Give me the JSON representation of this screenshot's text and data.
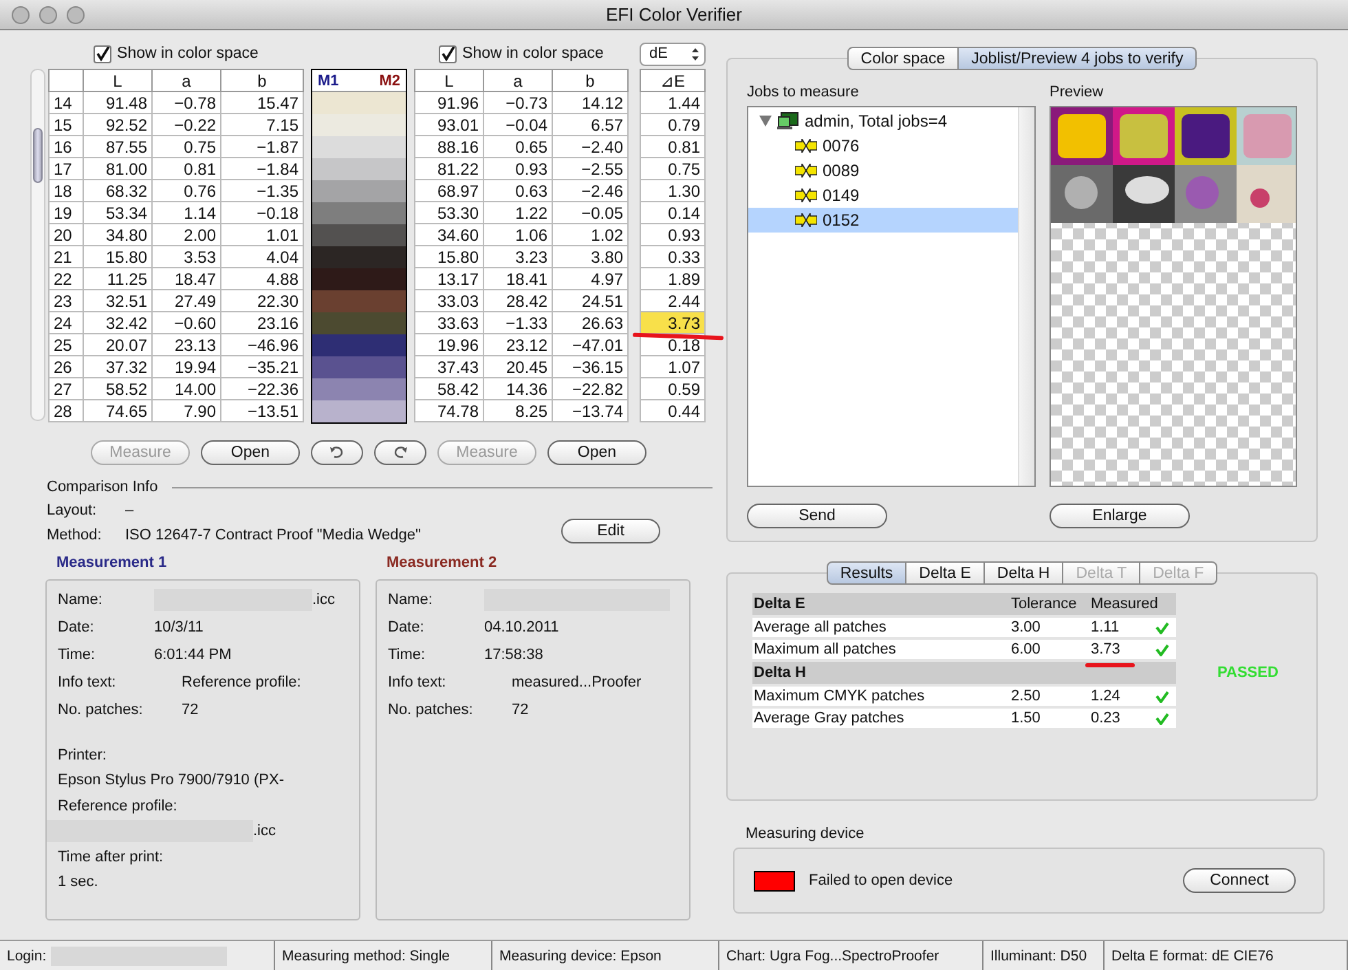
{
  "window": {
    "title": "EFI Color Verifier"
  },
  "left": {
    "checkbox_1": {
      "label": "Show in color space",
      "checked": true
    },
    "checkbox_2": {
      "label": "Show in color space",
      "checked": true
    },
    "de_select": {
      "value": "dE"
    },
    "table_1": {
      "columns": [
        "L",
        "a",
        "b"
      ]
    },
    "swatch_headers": [
      "M1",
      "M2"
    ],
    "table_2": {
      "columns": [
        "L",
        "a",
        "b"
      ]
    },
    "de_header": "⊿E",
    "rows": [
      {
        "index": "14",
        "m1": [
          "91.48",
          "−0.78",
          "15.47"
        ],
        "color": "#ece6d2",
        "m2": [
          "91.96",
          "−0.73",
          "14.12"
        ],
        "de": "1.44",
        "highlighted": false
      },
      {
        "index": "15",
        "m1": [
          "92.52",
          "−0.22",
          "7.15"
        ],
        "color": "#eceae0",
        "m2": [
          "93.01",
          "−0.04",
          "6.57"
        ],
        "de": "0.79",
        "highlighted": false
      },
      {
        "index": "16",
        "m1": [
          "87.55",
          "0.75",
          "−1.87"
        ],
        "color": "#dcdcdc",
        "m2": [
          "88.16",
          "0.65",
          "−2.40"
        ],
        "de": "0.81",
        "highlighted": false
      },
      {
        "index": "17",
        "m1": [
          "81.00",
          "0.81",
          "−1.84"
        ],
        "color": "#c6c6c8",
        "m2": [
          "81.22",
          "0.93",
          "−2.55"
        ],
        "de": "0.75",
        "highlighted": false
      },
      {
        "index": "18",
        "m1": [
          "68.32",
          "0.76",
          "−1.35"
        ],
        "color": "#a4a4a6",
        "m2": [
          "68.97",
          "0.63",
          "−2.46"
        ],
        "de": "1.30",
        "highlighted": false
      },
      {
        "index": "19",
        "m1": [
          "53.34",
          "1.14",
          "−0.18"
        ],
        "color": "#7e7e7e",
        "m2": [
          "53.30",
          "1.22",
          "−0.05"
        ],
        "de": "0.14",
        "highlighted": false
      },
      {
        "index": "20",
        "m1": [
          "34.80",
          "2.00",
          "1.01"
        ],
        "color": "#535150",
        "m2": [
          "34.60",
          "1.06",
          "1.02"
        ],
        "de": "0.93",
        "highlighted": false
      },
      {
        "index": "21",
        "m1": [
          "15.80",
          "3.53",
          "4.04"
        ],
        "color": "#2c2624",
        "m2": [
          "15.80",
          "3.23",
          "3.80"
        ],
        "de": "0.33",
        "highlighted": false
      },
      {
        "index": "22",
        "m1": [
          "11.25",
          "18.47",
          "4.88"
        ],
        "color": "#2e1a18",
        "m2": [
          "13.17",
          "18.41",
          "4.97"
        ],
        "de": "1.89",
        "highlighted": false
      },
      {
        "index": "23",
        "m1": [
          "32.51",
          "27.49",
          "22.30"
        ],
        "color": "#6a4030",
        "m2": [
          "33.03",
          "28.42",
          "24.51"
        ],
        "de": "2.44",
        "highlighted": false
      },
      {
        "index": "24",
        "m1": [
          "32.42",
          "−0.60",
          "23.16"
        ],
        "color": "#4c4a30",
        "m2": [
          "33.63",
          "−1.33",
          "26.63"
        ],
        "de": "3.73",
        "highlighted": true,
        "underlined": true
      },
      {
        "index": "25",
        "m1": [
          "20.07",
          "23.13",
          "−46.96"
        ],
        "color": "#2e2e74",
        "m2": [
          "19.96",
          "23.12",
          "−47.01"
        ],
        "de": "0.18",
        "highlighted": false
      },
      {
        "index": "26",
        "m1": [
          "37.32",
          "19.94",
          "−35.21"
        ],
        "color": "#5a5290",
        "m2": [
          "37.43",
          "20.45",
          "−36.15"
        ],
        "de": "1.07",
        "highlighted": false
      },
      {
        "index": "27",
        "m1": [
          "58.52",
          "14.00",
          "−22.36"
        ],
        "color": "#8c84b0",
        "m2": [
          "58.42",
          "14.36",
          "−22.82"
        ],
        "de": "0.59",
        "highlighted": false
      },
      {
        "index": "28",
        "m1": [
          "74.65",
          "7.90",
          "−13.51"
        ],
        "color": "#b8b2cc",
        "m2": [
          "74.78",
          "8.25",
          "−13.74"
        ],
        "de": "0.44",
        "highlighted": false
      }
    ],
    "buttons": [
      {
        "kind": "text",
        "label": "Measure",
        "disabled": true
      },
      {
        "kind": "text",
        "label": "Open",
        "disabled": false
      },
      {
        "kind": "undo",
        "disabled": false
      },
      {
        "kind": "redo",
        "disabled": false
      },
      {
        "kind": "text",
        "label": "Measure",
        "disabled": true
      },
      {
        "kind": "text",
        "label": "Open",
        "disabled": false
      }
    ],
    "comparison": {
      "title": "Comparison Info",
      "fields": [
        {
          "label": "Layout:",
          "value": "–"
        },
        {
          "label": "Method:",
          "value": "ISO 12647-7 Contract Proof \"Media Wedge\""
        }
      ],
      "edit_button": "Edit"
    },
    "measurements": [
      {
        "title": "Measurement 1",
        "color": "#2a2a88",
        "fields": [
          {
            "kind": "inline",
            "label": "Name:",
            "value": ".icc",
            "redacted": true
          },
          {
            "kind": "inline",
            "label": "Date:",
            "value": "10/3/11"
          },
          {
            "kind": "inline",
            "label": "Time:",
            "value": "6:01:44 PM"
          },
          {
            "kind": "inline",
            "label": "Info text:",
            "value": "Reference profile:"
          },
          {
            "kind": "inline",
            "label": "No. patches:",
            "value": "72"
          },
          {
            "kind": "stacked",
            "label": "Printer:",
            "value": "Epson Stylus Pro 7900/7910 (PX-"
          },
          {
            "kind": "stacked",
            "label": "Reference profile:",
            "value": ".icc",
            "redacted": true
          },
          {
            "kind": "stacked",
            "label": "Time after print:",
            "value": "1 sec."
          }
        ]
      },
      {
        "title": "Measurement 2",
        "color": "#8a2a22",
        "fields": [
          {
            "kind": "inline",
            "label": "Name:",
            "redacted": true
          },
          {
            "kind": "inline",
            "label": "Date:",
            "value": "04.10.2011"
          },
          {
            "kind": "inline",
            "label": "Time:",
            "value": "17:58:38"
          },
          {
            "kind": "inline",
            "label": "Info text:",
            "value": "measured...Proofer"
          },
          {
            "kind": "inline",
            "label": "No. patches:",
            "value": "72"
          }
        ]
      }
    ]
  },
  "right": {
    "tabs": [
      {
        "label": "Color space",
        "selected": false
      },
      {
        "label": "Joblist/Preview 4 jobs to verify",
        "selected": true
      }
    ],
    "jobs": {
      "title": "Jobs to measure",
      "root": {
        "label": "admin, Total jobs=4",
        "expanded": true,
        "children": [
          {
            "label": "0076",
            "selected": false
          },
          {
            "label": "0089",
            "selected": false
          },
          {
            "label": "0149",
            "selected": false
          },
          {
            "label": "0152",
            "selected": true
          }
        ]
      },
      "button": "Send"
    },
    "preview": {
      "title": "Preview",
      "button": "Enlarge"
    },
    "result_tabs": [
      {
        "label": "Results",
        "selected": true,
        "disabled": false
      },
      {
        "label": "Delta E",
        "selected": false,
        "disabled": false
      },
      {
        "label": "Delta H",
        "selected": false,
        "disabled": false
      },
      {
        "label": "Delta T",
        "selected": false,
        "disabled": true
      },
      {
        "label": "Delta F",
        "selected": false,
        "disabled": true
      }
    ],
    "results": {
      "columns": [
        "Tolerance",
        "Measured"
      ],
      "groups": [
        {
          "title": "Delta E",
          "rows": [
            {
              "label": "Average all patches",
              "tolerance": "3.00",
              "measured": "1.11",
              "passed": true
            },
            {
              "label": "Maximum all patches",
              "tolerance": "6.00",
              "measured": "3.73",
              "passed": true,
              "underlined": true
            }
          ]
        },
        {
          "title": "Delta H",
          "rows": [
            {
              "label": "Maximum CMYK patches",
              "tolerance": "2.50",
              "measured": "1.24",
              "passed": true
            },
            {
              "label": "Average Gray patches",
              "tolerance": "1.50",
              "measured": "0.23",
              "passed": true
            }
          ]
        }
      ],
      "verdict": "PASSED"
    },
    "device": {
      "title": "Measuring device",
      "status": "Failed to open device",
      "color": "#ff0000",
      "button": "Connect"
    }
  },
  "status_bar": [
    {
      "kind": "redacted",
      "label": "Login:"
    },
    {
      "kind": "text",
      "label": "Measuring method: Single"
    },
    {
      "kind": "text",
      "label": "Measuring device: Epson"
    },
    {
      "kind": "text",
      "label": "Chart: Ugra Fog...SpectroProofer"
    },
    {
      "kind": "text",
      "label": "Illuminant: D50"
    },
    {
      "kind": "text",
      "label": "Delta E format: dE CIE76"
    }
  ]
}
